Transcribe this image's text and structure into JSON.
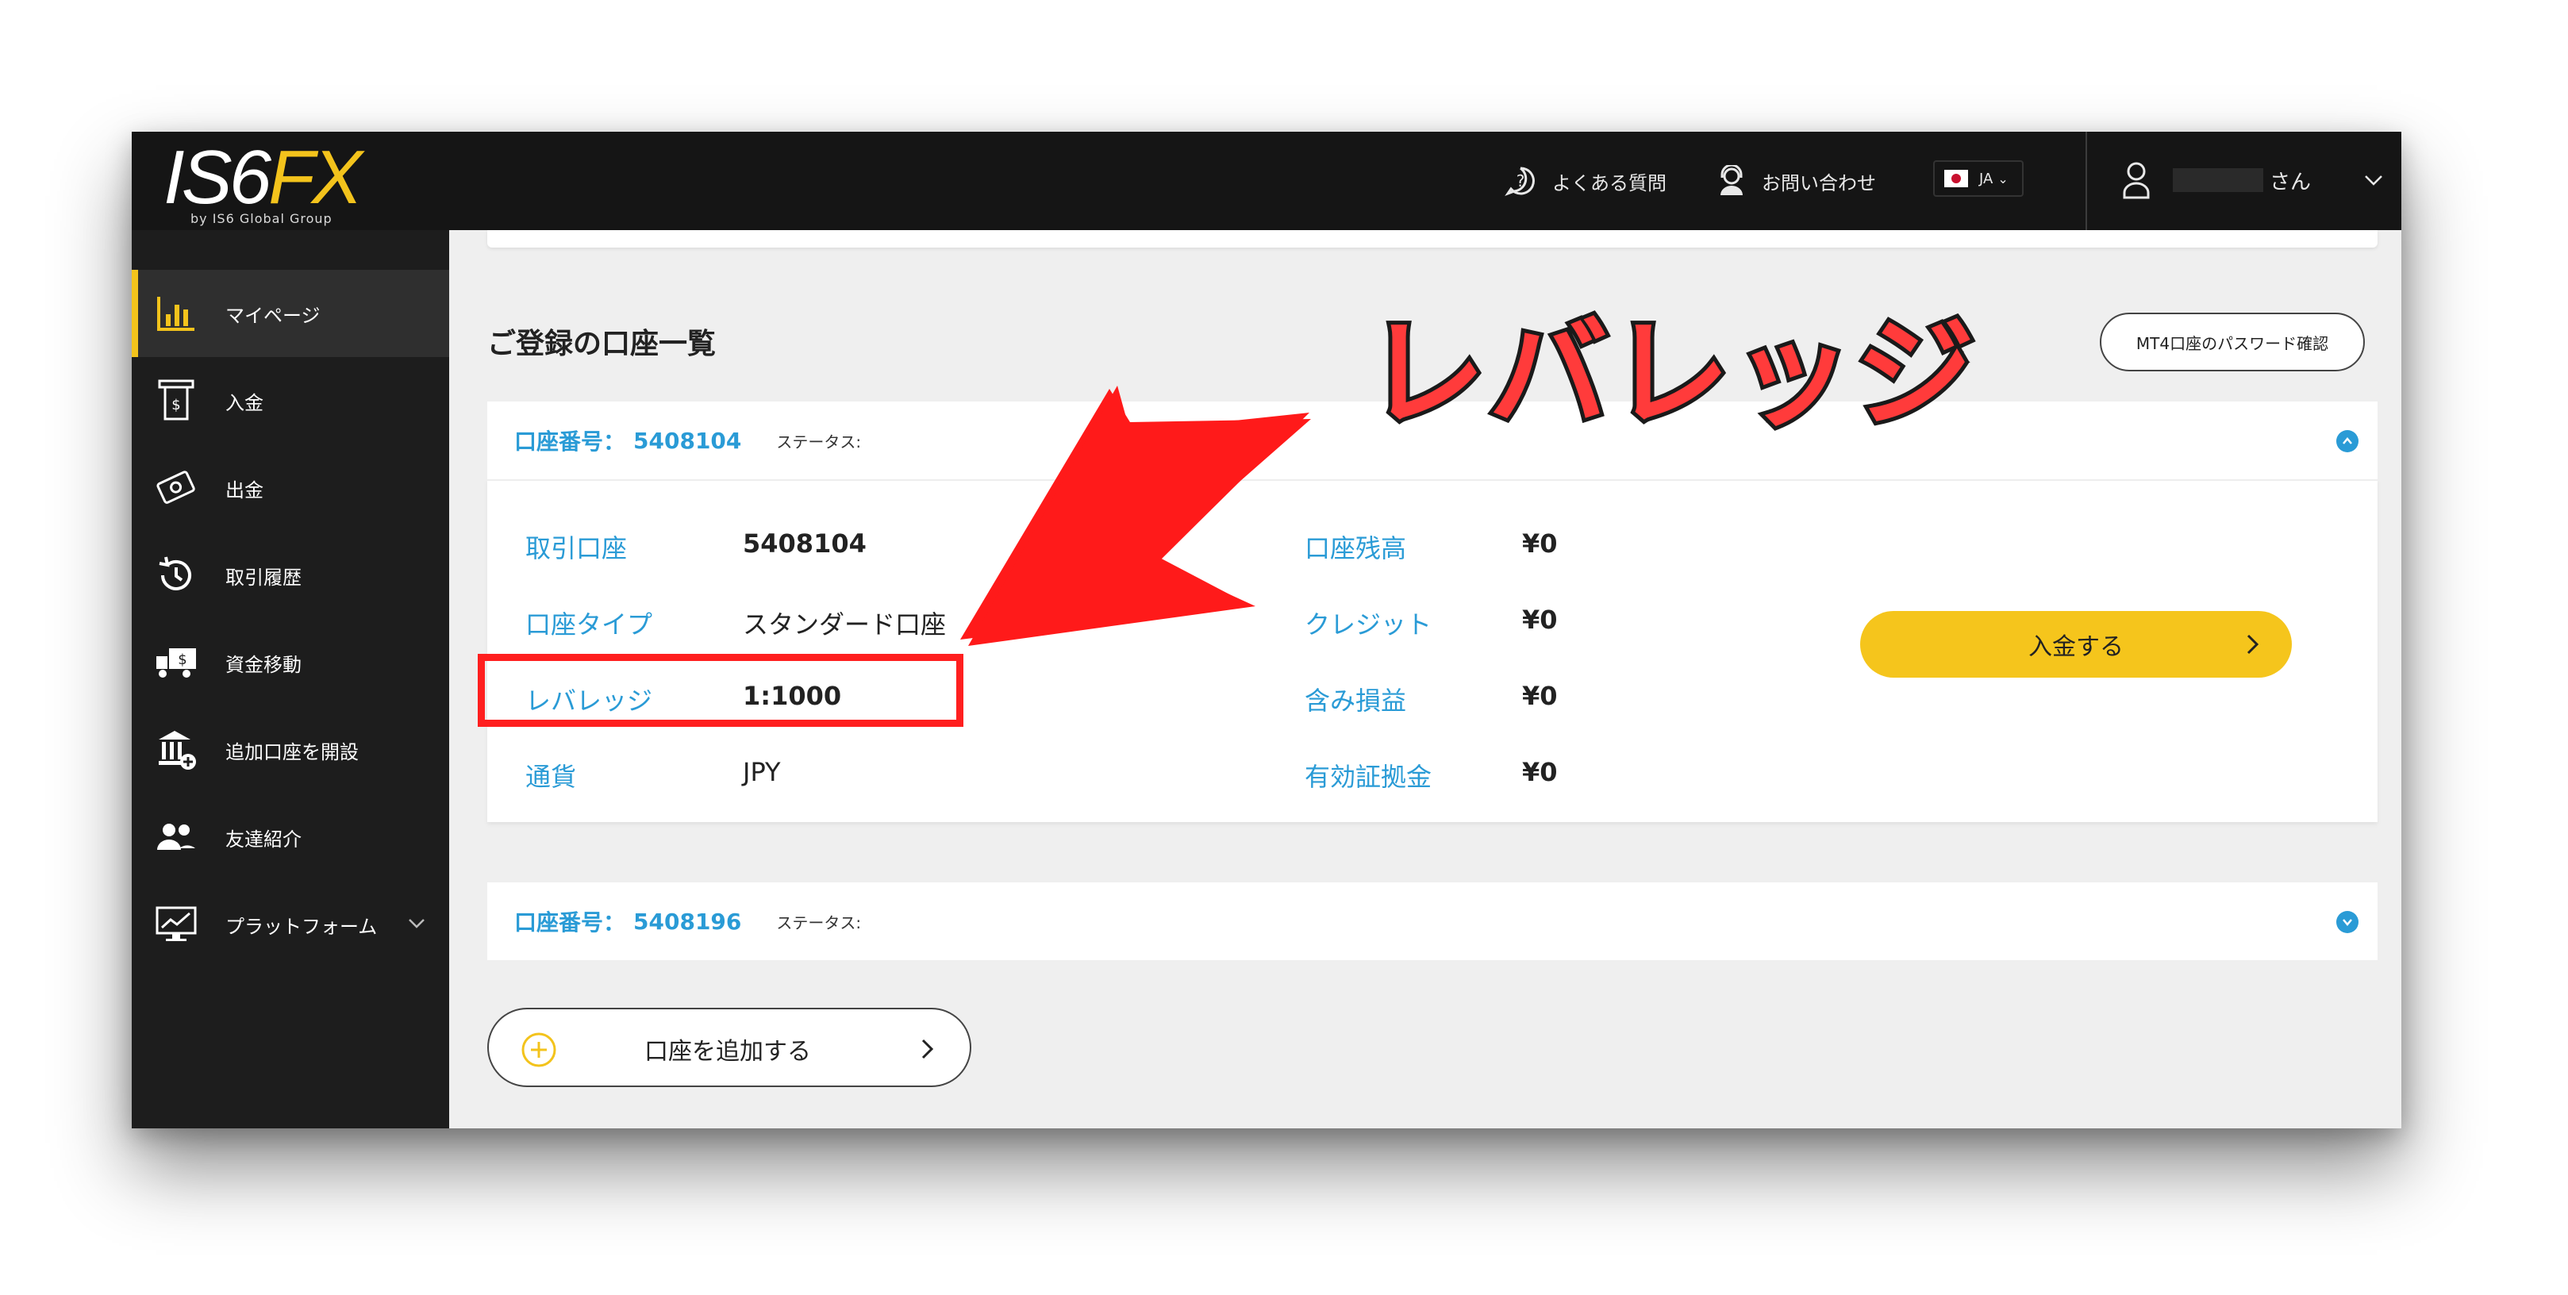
{
  "header": {
    "logo_text_main": "IS6",
    "logo_text_fx": "FX",
    "logo_sub": "by IS6 Global Group",
    "faq_label": "よくある質問",
    "contact_label": "お問い合わせ",
    "lang_label": "JA",
    "user_suffix": "さん"
  },
  "sidebar": {
    "items": [
      {
        "label": "マイページ",
        "icon": "bar-chart-icon"
      },
      {
        "label": "入金",
        "icon": "atm-deposit-icon"
      },
      {
        "label": "出金",
        "icon": "cash-withdraw-icon"
      },
      {
        "label": "取引履歴",
        "icon": "history-icon"
      },
      {
        "label": "資金移動",
        "icon": "truck-transfer-icon"
      },
      {
        "label": "追加口座を開設",
        "icon": "bank-add-icon"
      },
      {
        "label": "友達紹介",
        "icon": "users-icon"
      },
      {
        "label": "プラットフォーム",
        "icon": "monitor-chart-icon"
      }
    ]
  },
  "main": {
    "section_title": "ご登録の口座一覧",
    "password_button": "MT4口座のパスワード確認",
    "accounts": [
      {
        "number_label": "口座番号：",
        "number": "5408104",
        "status_label": "ステータス:",
        "expanded": true
      },
      {
        "number_label": "口座番号：",
        "number": "5408196",
        "status_label": "ステータス:",
        "expanded": false
      }
    ],
    "details": {
      "trading_account_label": "取引口座",
      "trading_account_value": "5408104",
      "account_type_label": "口座タイプ",
      "account_type_value": "スタンダード口座",
      "leverage_label": "レバレッジ",
      "leverage_value": "1:1000",
      "currency_label": "通貨",
      "currency_value": "JPY",
      "balance_label": "口座残高",
      "balance_value": "¥0",
      "credit_label": "クレジット",
      "credit_value": "¥0",
      "unrealized_label": "含み損益",
      "unrealized_value": "¥0",
      "margin_label": "有効証拠金",
      "margin_value": "¥0"
    },
    "deposit_button": "入金する",
    "add_account_button": "口座を追加する"
  },
  "annotation": {
    "callout_text": "レバレッジ",
    "color": "#ff1f1f"
  },
  "colors": {
    "accent_yellow": "#f5c51c",
    "link_blue": "#2a9bd6",
    "header_bg": "#151515",
    "sidebar_bg": "#1d1d1d"
  }
}
